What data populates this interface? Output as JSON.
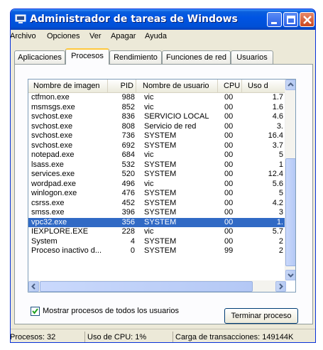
{
  "window": {
    "title": "Administrador de tareas de Windows",
    "accent": "#0054e3"
  },
  "menu": [
    "Archivo",
    "Opciones",
    "Ver",
    "Apagar",
    "Ayuda"
  ],
  "tabs": [
    {
      "label": "Aplicaciones",
      "active": false
    },
    {
      "label": "Procesos",
      "active": true
    },
    {
      "label": "Rendimiento",
      "active": false
    },
    {
      "label": "Funciones de red",
      "active": false
    },
    {
      "label": "Usuarios",
      "active": false
    }
  ],
  "columns": [
    "Nombre de imagen",
    "PID",
    "Nombre de usuario",
    "CPU",
    "Uso d"
  ],
  "rows": [
    [
      "ctfmon.exe",
      "988",
      "vic",
      "00",
      "1.7"
    ],
    [
      "msmsgs.exe",
      "852",
      "vic",
      "00",
      "1.6"
    ],
    [
      "svchost.exe",
      "836",
      "SERVICIO LOCAL",
      "00",
      "4.6"
    ],
    [
      "svchost.exe",
      "808",
      "Servicio de red",
      "00",
      "3."
    ],
    [
      "svchost.exe",
      "736",
      "SYSTEM",
      "00",
      "16.4"
    ],
    [
      "svchost.exe",
      "692",
      "SYSTEM",
      "00",
      "3.7"
    ],
    [
      "notepad.exe",
      "684",
      "vic",
      "00",
      "5"
    ],
    [
      "lsass.exe",
      "532",
      "SYSTEM",
      "00",
      "1"
    ],
    [
      "services.exe",
      "520",
      "SYSTEM",
      "00",
      "12.4"
    ],
    [
      "wordpad.exe",
      "496",
      "vic",
      "00",
      "5.6"
    ],
    [
      "winlogon.exe",
      "476",
      "SYSTEM",
      "00",
      "5"
    ],
    [
      "csrss.exe",
      "452",
      "SYSTEM",
      "00",
      "4.2"
    ],
    [
      "smss.exe",
      "396",
      "SYSTEM",
      "00",
      "3"
    ],
    [
      "vpc32.exe",
      "356",
      "SYSTEM",
      "00",
      "1."
    ],
    [
      "IEXPLORE.EXE",
      "228",
      "vic",
      "00",
      "5.7"
    ],
    [
      "System",
      "4",
      "SYSTEM",
      "00",
      "2"
    ],
    [
      "Proceso inactivo d...",
      "0",
      "SYSTEM",
      "99",
      "2"
    ]
  ],
  "selected_row": 13,
  "checkbox": {
    "label": "Mostrar procesos de todos los usuarios",
    "checked": true
  },
  "end_button": "Terminar proceso",
  "status": {
    "processes": "Procesos: 32",
    "cpu": "Uso de CPU: 1%",
    "commit": "Carga de transacciones: 149144K"
  }
}
